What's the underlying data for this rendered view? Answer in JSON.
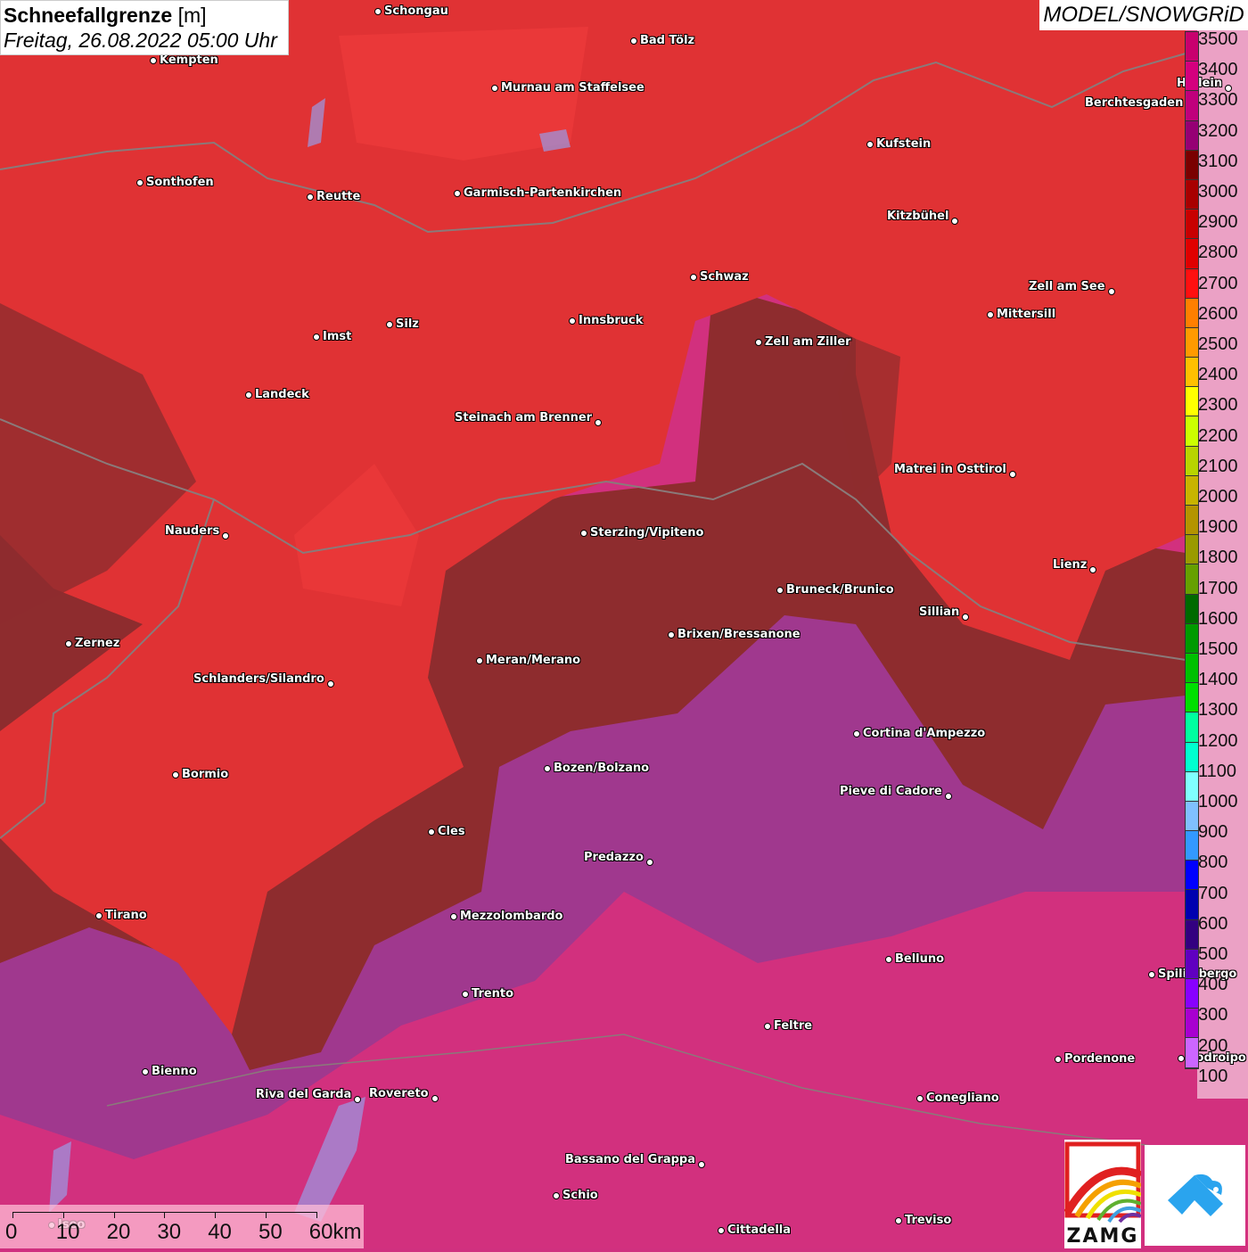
{
  "header": {
    "title": "Schneefallgrenze",
    "unit": "[m]",
    "datetime": "Freitag, 26.08.2022 05:00 Uhr"
  },
  "model_label": "MODEL/SNOWGRiD",
  "legend": {
    "labels": [
      "3500",
      "3400",
      "3300",
      "3200",
      "3100",
      "3000",
      "2900",
      "2800",
      "2700",
      "2600",
      "2500",
      "2400",
      "2300",
      "2200",
      "2100",
      "2000",
      "1900",
      "1800",
      "1700",
      "1600",
      "1500",
      "1400",
      "1300",
      "1200",
      "1100",
      "1000",
      "900",
      "800",
      "700",
      "600",
      "500",
      "400",
      "300",
      "200",
      "100"
    ],
    "colors": [
      "#c8006e",
      "#d4007e",
      "#c0007c",
      "#960074",
      "#7a0000",
      "#a80000",
      "#c80000",
      "#e00000",
      "#ff1010",
      "#ff7f00",
      "#ff9a00",
      "#ffc000",
      "#ffff00",
      "#ccff00",
      "#b8d400",
      "#c8b400",
      "#b49400",
      "#9a9a00",
      "#66a000",
      "#006a00",
      "#009a00",
      "#00c000",
      "#00e000",
      "#00ffa0",
      "#00ffd0",
      "#80ffff",
      "#80c0ff",
      "#3399ff",
      "#0000ff",
      "#0000b0",
      "#330080",
      "#6000c0",
      "#8800ff",
      "#a800d0",
      "#cc66ff"
    ]
  },
  "map_colors": {
    "high_red": "#e03234",
    "dark_red": "#8e2c2e",
    "purple": "#a0388e",
    "magenta": "#d2307e",
    "border": "#8a7a7a",
    "lake": "#9a9ae6"
  },
  "cities": [
    "Schongau",
    "Bad Tölz",
    "Kempten",
    "Murnau am Staffelsee",
    "Hallein",
    "Berchtesgaden",
    "Kufstein",
    "Sonthofen",
    "Reutte",
    "Garmisch-Partenkirchen",
    "Kitzbühel",
    "Schwaz",
    "Zell am See",
    "Mittersill",
    "Innsbruck",
    "Silz",
    "Imst",
    "Zell am Ziller",
    "Landeck",
    "Steinach am Brenner",
    "Matrei in Osttirol",
    "Nauders",
    "Sterzing/Vipiteno",
    "Lienz",
    "Bruneck/Brunico",
    "Sillian",
    "Brixen/Bressanone",
    "Zernez",
    "Meran/Merano",
    "Schlanders/Silandro",
    "Cortina d'Ampezzo",
    "Bozen/Bolzano",
    "Bormio",
    "Pieve di Cadore",
    "Cles",
    "Predazzo",
    "Tirano",
    "Mezzolombardo",
    "Belluno",
    "Spilimbergo",
    "Trento",
    "Feltre",
    "Pordenone",
    "Codroipo",
    "Bienno",
    "Riva del Garda",
    "Rovereto",
    "Conegliano",
    "Bassano del Grappa",
    "Schio",
    "Iseo",
    "Treviso",
    "Cittadella"
  ],
  "scale": {
    "labels": [
      "0",
      "10",
      "20",
      "30",
      "40",
      "50",
      "60km"
    ]
  },
  "logos": {
    "zamg": "ZAMG"
  }
}
